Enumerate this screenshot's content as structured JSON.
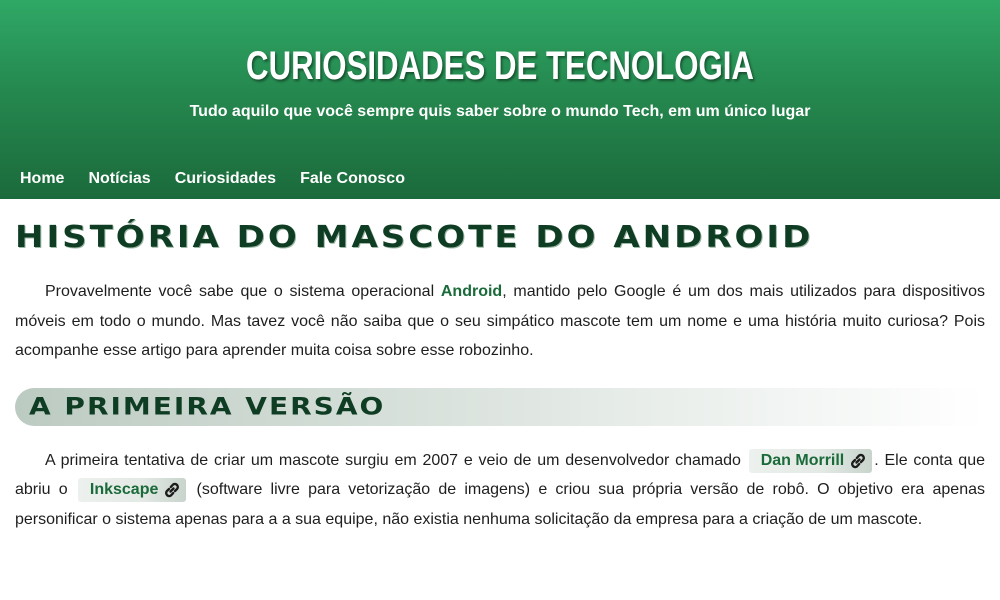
{
  "header": {
    "title": "CURIOSIDADES DE TECNOLOGIA",
    "subtitle": "Tudo aquilo que você sempre quis saber sobre o mundo Tech, em um único lugar"
  },
  "nav": {
    "items": [
      {
        "label": "Home"
      },
      {
        "label": "Notícias"
      },
      {
        "label": "Curiosidades"
      },
      {
        "label": "Fale Conosco"
      }
    ]
  },
  "article": {
    "title": "HISTÓRIA DO MASCOTE DO ANDROID",
    "intro": {
      "before": "Provavelmente você sabe que o sistema operacional ",
      "highlight": "Android",
      "after": ", mantido pelo Google é um dos mais utilizados para dispositivos móveis em todo o mundo. Mas tavez você não saiba que o seu simpático mascote tem um nome e uma história muito curiosa? Pois acompanhe esse artigo para aprender muita coisa sobre esse robozinho."
    },
    "section1": {
      "title": "A PRIMEIRA VERSÃO",
      "p1_a": "A primeira tentativa de criar um mascote surgiu em 2007 e veio de um desenvolvedor chamado ",
      "link1": "Dan Morrill",
      "p1_b": ". Ele conta que abriu o ",
      "link2": "Inkscape",
      "p1_c": " (software livre para vetorização de imagens) e criou sua própria versão de robô. O objetivo era apenas personificar o sistema apenas para a a sua equipe, não existia nenhuma solicitação da empresa para a criação de um mascote."
    }
  },
  "colors": {
    "header_green": "#25894f",
    "accent_text": "#1a6a3a",
    "heading_dark": "#0f3d24"
  },
  "icons": {
    "link": "chain-link-icon"
  }
}
